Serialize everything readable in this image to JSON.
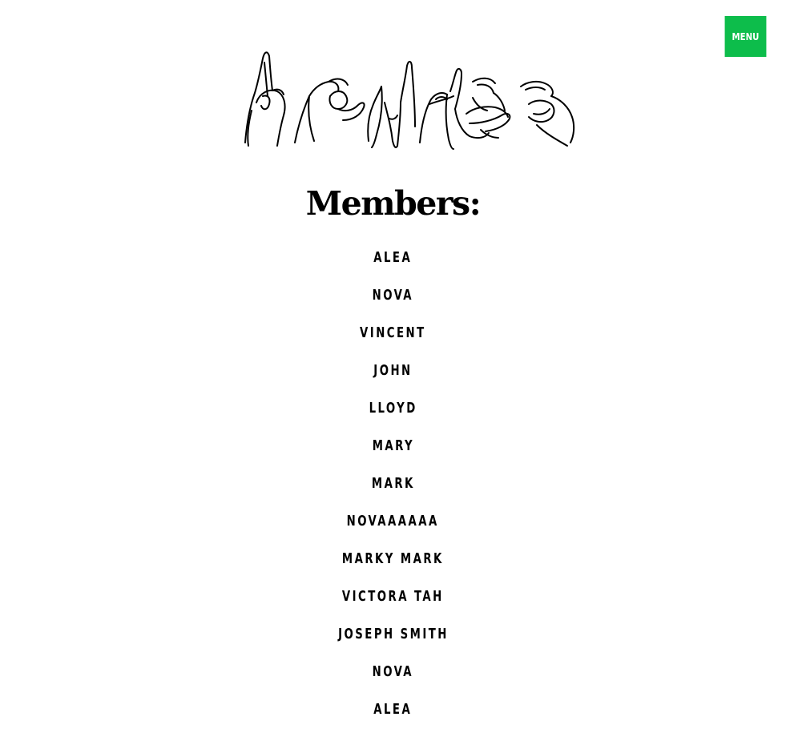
{
  "header": {
    "menu_label": "MENU",
    "menu_color": "#0dbd4b",
    "logo_icon": "sign-language-hands-logo-icon"
  },
  "main": {
    "title": "Members:",
    "members": [
      "ALEA",
      "NOVA",
      "VINCENT",
      "JOHN",
      "LLOYD",
      "MARY",
      "MARK",
      "NOVAAAAAA",
      "MARKY MARK",
      "VICTORA TAH",
      "JOSEPH SMITH",
      "NOVA",
      "ALEA"
    ]
  }
}
